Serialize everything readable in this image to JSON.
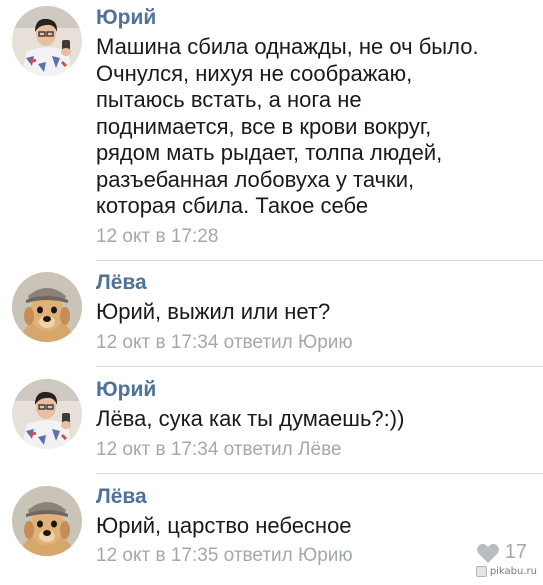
{
  "comments": [
    {
      "author": "Юрий",
      "avatar": "yuri-avatar",
      "text": "Машина сбила однажды, не оч было.\nОчнулся, нихуя не соображаю,\nпытаюсь встать, а нога не\nподнимается, все в крови вокруг,\nрядом мать рыдает, толпа людей,\nразъебанная лобовуха у тачки,\nкоторая сбила. Такое себе",
      "meta": "12 окт в 17:28"
    },
    {
      "author": "Лёва",
      "avatar": "dog-avatar",
      "text": "Юрий, выжил или нет?",
      "meta": "12 окт в 17:34 ответил Юрию"
    },
    {
      "author": "Юрий",
      "avatar": "yuri-avatar",
      "text": "Лёва, сука как ты думаешь?:))",
      "meta": "12 окт в 17:34 ответил Лёве"
    },
    {
      "author": "Лёва",
      "avatar": "dog-avatar",
      "text": "Юрий, царство небесное",
      "meta": "12 окт в 17:35 ответил Юрию",
      "likes": "17"
    }
  ],
  "watermark": "pikabu.ru",
  "colors": {
    "author": "#4e729a",
    "meta": "#a3a8ae",
    "text": "#1a1a1a",
    "divider": "#d7dbe0"
  }
}
